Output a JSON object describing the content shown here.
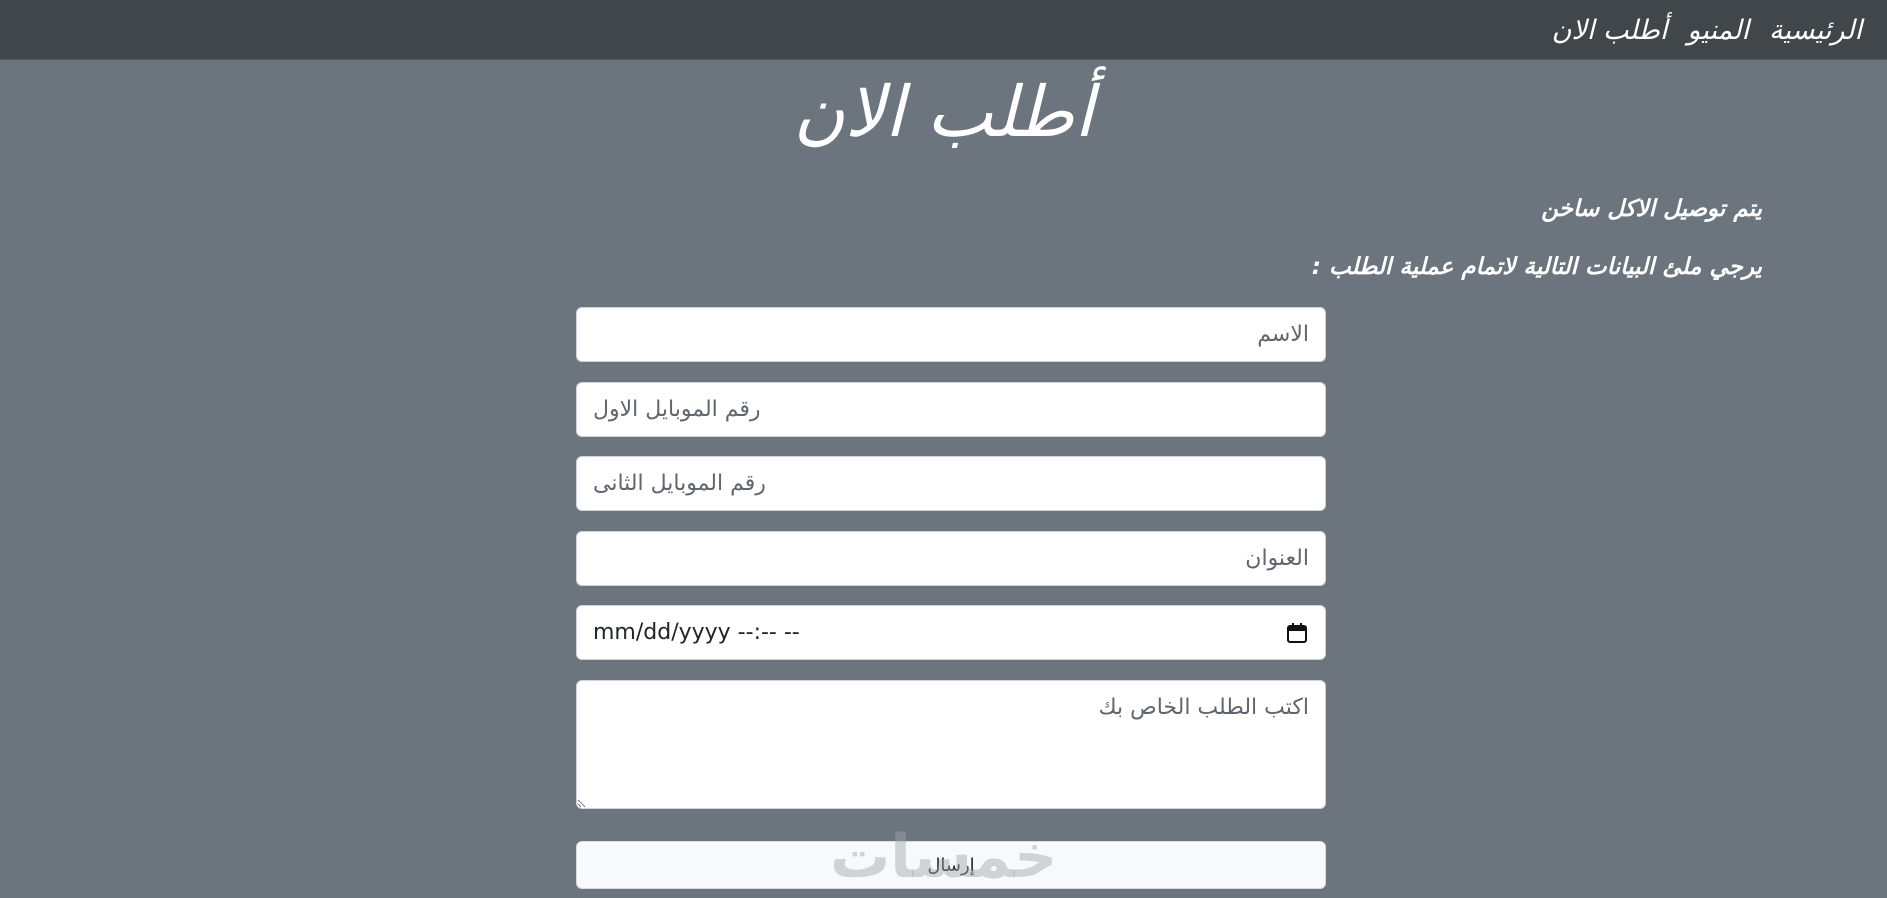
{
  "nav": {
    "items": [
      {
        "label": "الرئيسية"
      },
      {
        "label": "المنيو"
      },
      {
        "label": "أطلب الان"
      }
    ]
  },
  "page": {
    "title": "أطلب الان",
    "info_line_1": "يتم توصيل الاكل ساخن",
    "info_line_2": "يرجي ملئ البيانات التالية لاتمام عملية الطلب :"
  },
  "form": {
    "name_placeholder": "الاسم",
    "phone1_placeholder": "رقم الموبايل الاول",
    "phone2_placeholder": "رقم الموبايل الثانى",
    "address_placeholder": "العنوان",
    "datetime_value": "mm/dd/yyyy --:-- --",
    "notes_placeholder": "اكتب الطلب الخاص بك",
    "submit_label": "إرسال"
  },
  "watermark": {
    "text": "خمسات"
  },
  "icons": {
    "calendar": "calendar-icon"
  },
  "colors": {
    "navbar": "#41464b",
    "background": "#6c757d"
  }
}
